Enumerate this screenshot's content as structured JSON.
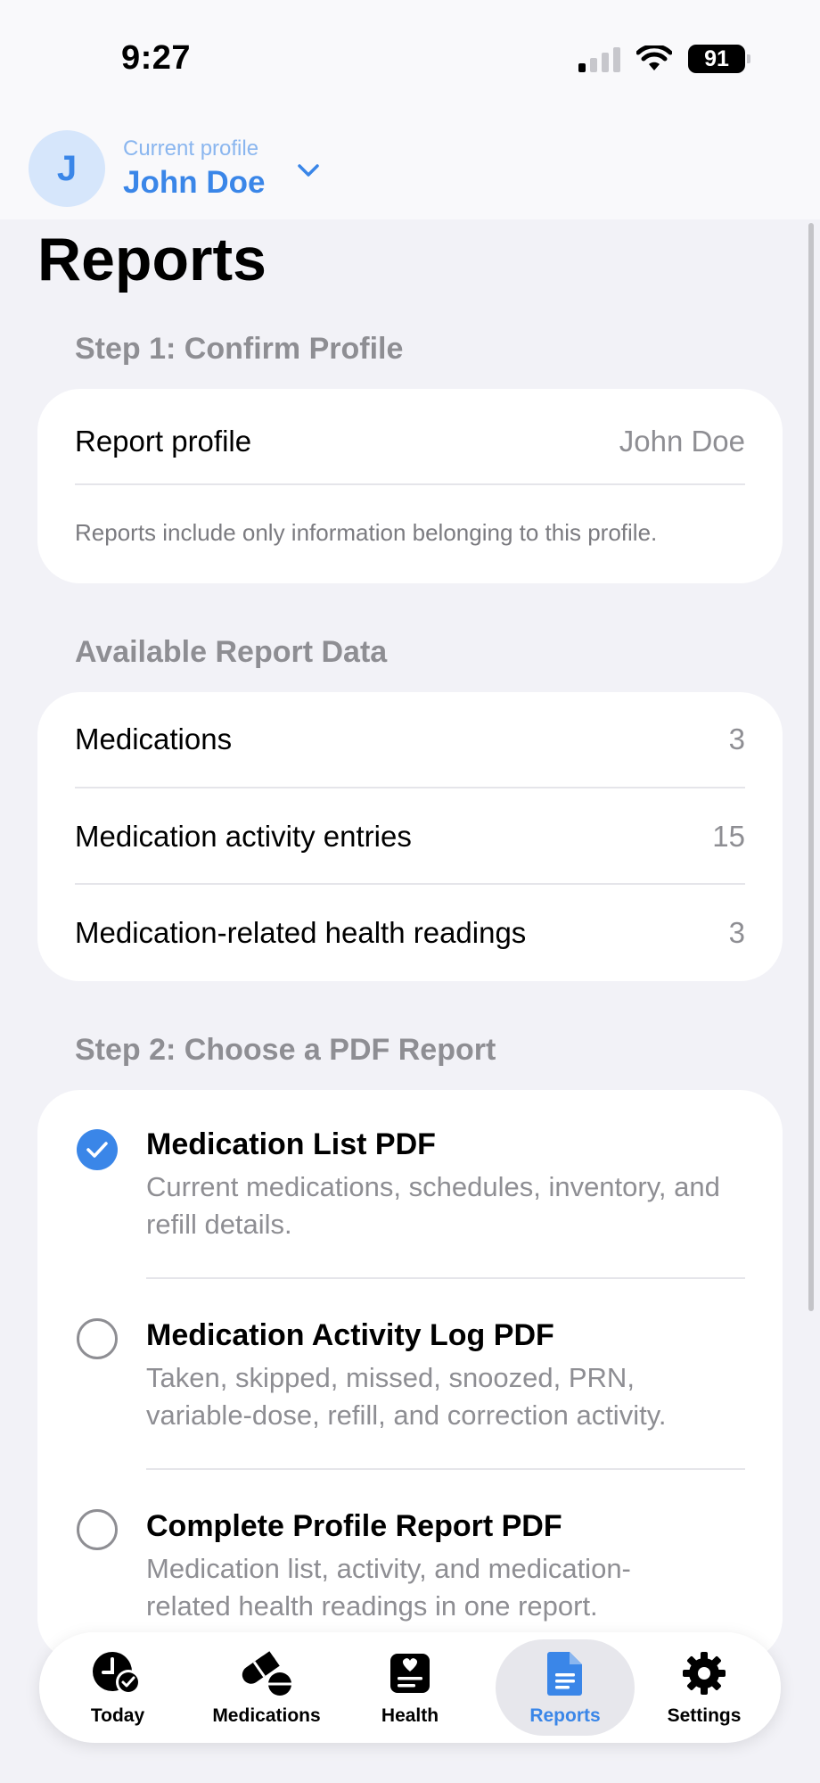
{
  "status_bar": {
    "time": "9:27",
    "battery": "91"
  },
  "profile": {
    "caption": "Current profile",
    "name": "John Doe",
    "initial": "J"
  },
  "page": {
    "title": "Reports"
  },
  "step1": {
    "header": "Step 1: Confirm Profile",
    "row_label": "Report profile",
    "row_value": "John Doe",
    "note": "Reports include only information belonging to this profile."
  },
  "available": {
    "header": "Available Report Data",
    "rows": [
      {
        "label": "Medications",
        "value": "3"
      },
      {
        "label": "Medication activity entries",
        "value": "15"
      },
      {
        "label": "Medication-related health readings",
        "value": "3"
      }
    ]
  },
  "step2": {
    "header": "Step 2: Choose a PDF Report",
    "options": [
      {
        "title": "Medication List PDF",
        "desc1": "Current medications, schedules, inventory, and",
        "desc2": "refill details.",
        "selected": true
      },
      {
        "title": "Medication Activity Log PDF",
        "desc1": "Taken, skipped, missed, snoozed, PRN,",
        "desc2": "variable-dose, refill, and correction activity.",
        "selected": false
      },
      {
        "title": "Complete Profile Report PDF",
        "desc1": "Medication list, activity, and medication-",
        "desc2": "related health readings in one report.",
        "selected": false
      }
    ]
  },
  "tabs": [
    {
      "label": "Today",
      "icon": "clock-check-icon"
    },
    {
      "label": "Medications",
      "icon": "pills-icon"
    },
    {
      "label": "Health",
      "icon": "heart-chart-icon"
    },
    {
      "label": "Reports",
      "icon": "document-icon",
      "active": true
    },
    {
      "label": "Settings",
      "icon": "gear-icon"
    }
  ],
  "colors": {
    "accent": "#3a86e8",
    "background": "#f2f2f7",
    "secondary_text": "#8e8e93"
  }
}
